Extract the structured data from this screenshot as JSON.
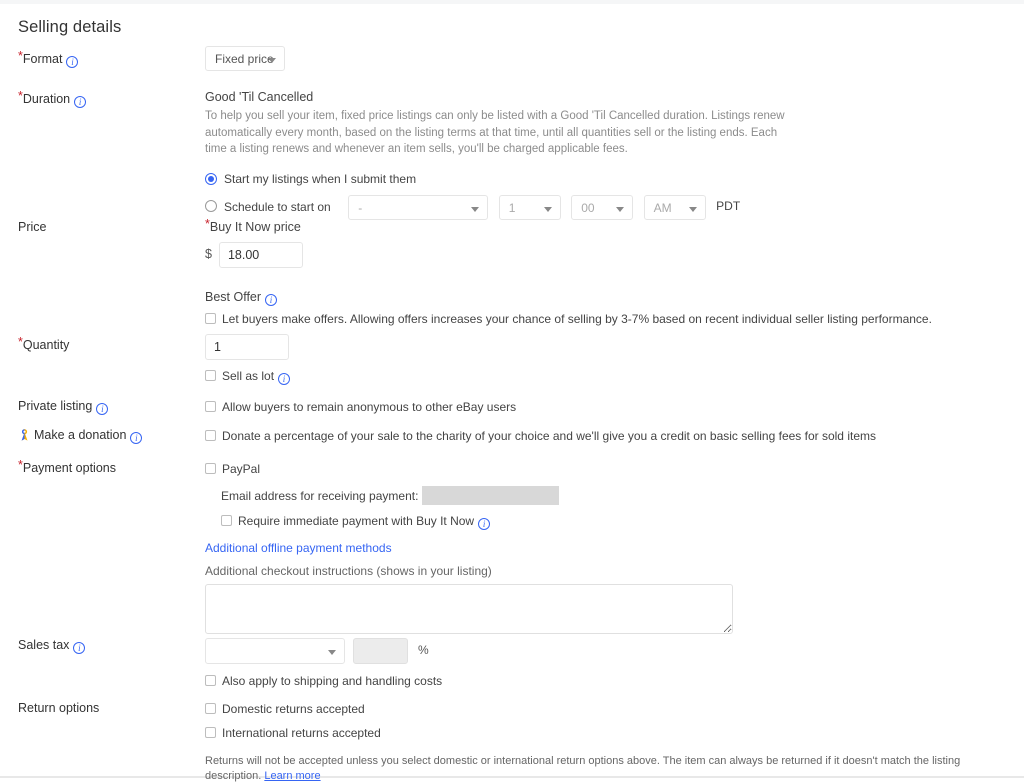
{
  "section": {
    "title": "Selling details"
  },
  "format": {
    "label": "Format",
    "required": true,
    "info_icon": "info-circle-icon",
    "selected": "Fixed price"
  },
  "duration": {
    "label": "Duration",
    "required": true,
    "info_icon": "info-circle-icon",
    "heading": "Good 'Til Cancelled",
    "description": "To help you sell your item, fixed price listings can only be listed with a Good 'Til Cancelled duration. Listings renew automatically every month, based on the listing terms at that time, until all quantities sell or the listing ends. Each time a listing renews and whenever an item sells, you'll be charged applicable fees.",
    "start_now_label": "Start my listings when I submit them",
    "start_now_selected": true,
    "schedule_label": "Schedule to start on",
    "schedule_selected": false,
    "date_value": "-",
    "hour_value": "1",
    "minute_value": "00",
    "meridiem_value": "AM",
    "timezone": "PDT"
  },
  "price": {
    "label": "Price",
    "bin_label": "Buy It Now price",
    "bin_required": true,
    "currency_symbol": "$",
    "bin_value": "18.00",
    "best_offer_label": "Best Offer",
    "best_offer_info_icon": "info-circle-icon",
    "best_offer_checkbox_label": "Let buyers make offers. Allowing offers increases your chance of selling by 3-7% based on recent individual seller listing performance.",
    "best_offer_checked": false
  },
  "quantity": {
    "label": "Quantity",
    "required": true,
    "value": "1",
    "sell_as_lot_label": "Sell as lot",
    "sell_as_lot_info_icon": "info-circle-icon",
    "sell_as_lot_checked": false
  },
  "private_listing": {
    "label": "Private listing",
    "info_icon": "info-circle-icon",
    "checkbox_label": "Allow buyers to remain anonymous to other eBay users",
    "checked": false
  },
  "donation": {
    "icon": "charity-ribbon-icon",
    "label": "Make a donation",
    "info_icon": "info-circle-icon",
    "checkbox_label": "Donate a percentage of your sale to the charity of your choice and we'll give you a credit on basic selling fees for sold items",
    "checked": false
  },
  "payment_options": {
    "label": "Payment options",
    "required": true,
    "paypal_label": "PayPal",
    "paypal_checked": false,
    "email_label": "Email address for receiving payment:",
    "email_value": "",
    "immediate_payment_label": "Require immediate payment with Buy It Now",
    "immediate_payment_info_icon": "info-circle-icon",
    "immediate_payment_checked": false,
    "offline_methods_link": "Additional offline payment methods",
    "checkout_instructions_label": "Additional checkout instructions (shows in your listing)",
    "checkout_instructions_value": ""
  },
  "sales_tax": {
    "label": "Sales tax",
    "info_icon": "info-circle-icon",
    "state_value": "",
    "rate_value": "",
    "percent_symbol": "%",
    "shipping_checkbox_label": "Also apply to shipping and handling costs",
    "shipping_checked": false
  },
  "return_options": {
    "label": "Return options",
    "domestic_label": "Domestic returns accepted",
    "domestic_checked": false,
    "international_label": "International returns accepted",
    "international_checked": false,
    "disclaimer": "Returns will not be accepted unless you select domestic or international return options above. The item can always be returned if it doesn't match the listing description.",
    "learn_more": "Learn more"
  },
  "colors": {
    "accent": "#3665f3",
    "required": "#c7202a",
    "text": "#333333",
    "muted": "#8c8c8c"
  }
}
